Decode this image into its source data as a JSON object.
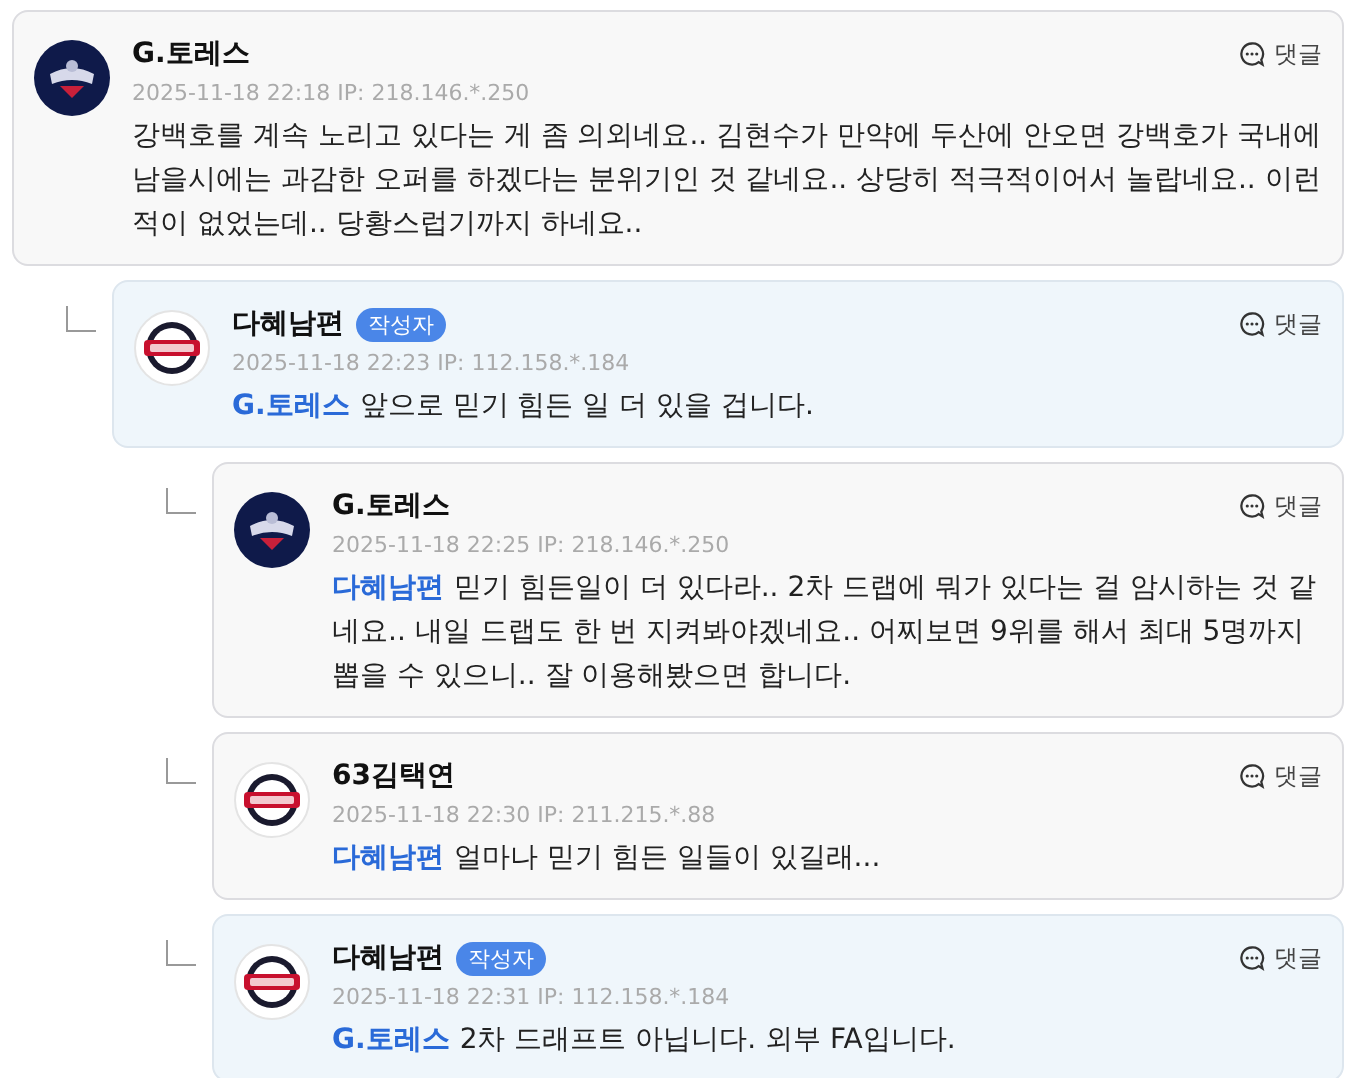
{
  "comments": [
    {
      "author": "G.토레스",
      "avatar": {
        "kind": "emblem"
      },
      "highlighted": false,
      "meta": "2025-11-18 22:18 IP: 218.146.*.250",
      "reply_label": "댓글",
      "text": "강백호를 계속 노리고 있다는 게 좀 의외네요.. 김현수가 만약에 두산에 안오면 강백호가 국내에 남을시에는 과감한 오퍼를 하겠다는 분위기인 것 같네요.. 상당히 적극적이어서 놀랍네요.. 이런 적이 없었는데.. 당황스럽기까지 하네요..",
      "children": [
        {
          "author": "다혜남편",
          "badge": "작성자",
          "avatar": {
            "kind": "bears"
          },
          "highlighted": true,
          "meta": "2025-11-18 22:23 IP: 112.158.*.184",
          "reply_label": "댓글",
          "mention": "G.토레스",
          "text": "앞으로 믿기 힘든 일 더 있을 겁니다.",
          "children": [
            {
              "author": "G.토레스",
              "avatar": {
                "kind": "emblem"
              },
              "highlighted": false,
              "meta": "2025-11-18 22:25 IP: 218.146.*.250",
              "reply_label": "댓글",
              "mention": "다혜남편",
              "text": "믿기 힘든일이 더 있다라.. 2차 드랩에 뭐가 있다는 걸 암시하는 것 같네요.. 내일 드랩도 한 번 지켜봐야겠네요.. 어찌보면 9위를 해서 최대 5명까지 뽑을 수 있으니.. 잘 이용해봤으면 합니다."
            },
            {
              "author": "63김택연",
              "avatar": {
                "kind": "bears"
              },
              "highlighted": false,
              "meta": "2025-11-18 22:30 IP: 211.215.*.88",
              "reply_label": "댓글",
              "mention": "다혜남편",
              "text": "얼마나 믿기 힘든 일들이 있길래..."
            },
            {
              "author": "다혜남편",
              "badge": "작성자",
              "avatar": {
                "kind": "bears"
              },
              "highlighted": true,
              "meta": "2025-11-18 22:31 IP: 112.158.*.184",
              "reply_label": "댓글",
              "mention": "G.토레스",
              "text": "2차 드래프트 아닙니다. 외부 FA입니다."
            }
          ]
        }
      ]
    }
  ]
}
